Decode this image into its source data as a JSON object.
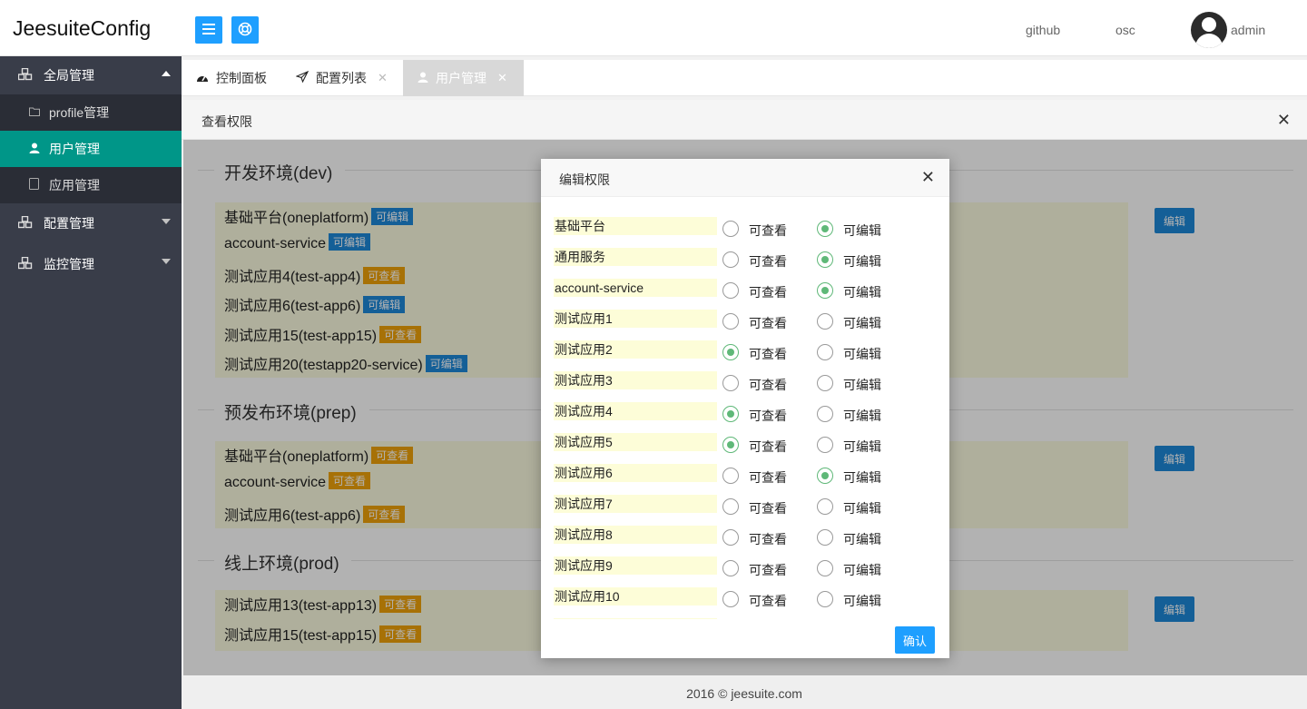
{
  "header": {
    "brand": "JeesuiteConfig",
    "links": {
      "github": "github",
      "osc": "osc",
      "user": "admin"
    }
  },
  "sidebar": {
    "groups": [
      {
        "label": "全局管理",
        "icon": "cubes-icon",
        "expanded": true
      },
      {
        "label": "配置管理",
        "icon": "cubes-icon",
        "expanded": false
      },
      {
        "label": "监控管理",
        "icon": "cubes-icon",
        "expanded": false
      }
    ],
    "items": [
      {
        "label": "profile管理",
        "icon": "folder-icon",
        "active": false
      },
      {
        "label": "用户管理",
        "icon": "user-icon",
        "active": true
      },
      {
        "label": "应用管理",
        "icon": "file-icon",
        "active": false
      }
    ]
  },
  "tabs": [
    {
      "label": "控制面板",
      "icon": "dashboard-icon"
    },
    {
      "label": "配置列表",
      "icon": "send-icon",
      "close": "✕"
    },
    {
      "label": "用户管理",
      "icon": "user-icon",
      "close": "✕",
      "active": true
    }
  ],
  "panel": {
    "title": "查看权限",
    "close": "✕"
  },
  "envs": [
    {
      "title": "开发环境(dev)",
      "edit_label": "编辑",
      "apps": [
        {
          "name": "基础平台(oneplatform)",
          "perm": "可编辑"
        },
        {
          "name": "account-service",
          "perm": "可编辑"
        },
        {
          "name": "测试应用4(test-app4)",
          "perm": "可查看"
        },
        {
          "name": "测试应用6(test-app6)",
          "perm": "可编辑"
        },
        {
          "name": "测试应用15(test-app15)",
          "perm": "可查看"
        },
        {
          "name": "测试应用20(testapp20-service)",
          "perm": "可编辑"
        }
      ]
    },
    {
      "title": "预发布环境(prep)",
      "edit_label": "编辑",
      "apps": [
        {
          "name": "基础平台(oneplatform)",
          "perm": "可查看"
        },
        {
          "name": "account-service",
          "perm": "可查看"
        },
        {
          "name": "测试应用6(test-app6)",
          "perm": "可查看"
        }
      ]
    },
    {
      "title": "线上环境(prod)",
      "edit_label": "编辑",
      "apps": [
        {
          "name": "测试应用13(test-app13)",
          "perm": "可查看"
        },
        {
          "name": "测试应用15(test-app15)",
          "perm": "可查看"
        }
      ]
    }
  ],
  "footer": "2016 ©  jeesuite.com",
  "modal": {
    "title": "编辑权限",
    "close": "✕",
    "view_label": "可查看",
    "edit_label": "可编辑",
    "confirm": "确认",
    "rows": [
      {
        "name": "基础平台",
        "selected": "edit"
      },
      {
        "name": "通用服务",
        "selected": "edit"
      },
      {
        "name": "account-service",
        "selected": "edit"
      },
      {
        "name": "测试应用1",
        "selected": "none"
      },
      {
        "name": "测试应用2",
        "selected": "view"
      },
      {
        "name": "测试应用3",
        "selected": "none"
      },
      {
        "name": "测试应用4",
        "selected": "view"
      },
      {
        "name": "测试应用5",
        "selected": "view"
      },
      {
        "name": "测试应用6",
        "selected": "edit"
      },
      {
        "name": "测试应用7",
        "selected": "none"
      },
      {
        "name": "测试应用8",
        "selected": "none"
      },
      {
        "name": "测试应用9",
        "selected": "none"
      },
      {
        "name": "测试应用10",
        "selected": "none"
      }
    ]
  },
  "colors": {
    "accent": "#1e9fff",
    "active_nav": "#009688",
    "sidebar": "#393d49",
    "radio_on": "#5fb878",
    "badge_edit": "#1e88d8",
    "badge_view": "#f0a30a"
  }
}
